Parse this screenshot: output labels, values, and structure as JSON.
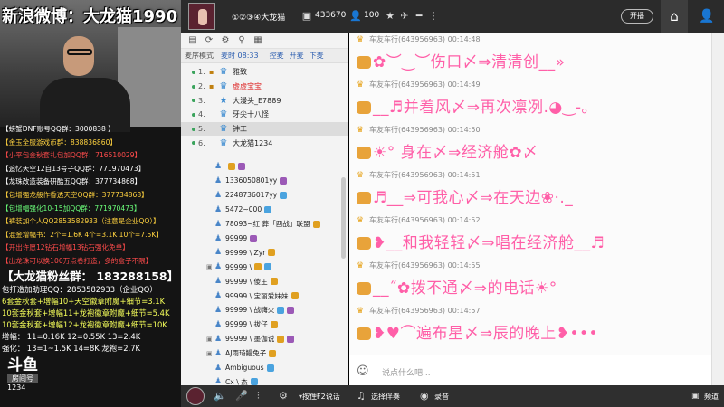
{
  "stream": {
    "title": "新浪微博：大龙猫1990",
    "lines": [
      {
        "text": "【螃蟹DNF账号QQ群：3000838 】",
        "cls": ""
      },
      {
        "text": "【金玉全服游戏币群：838836860】",
        "cls": "y"
      },
      {
        "text": "【小平包金秋套礼包加QQ群：716510029】",
        "cls": "r"
      },
      {
        "text": "【追忆天空12自13号子QQ群：771970473】",
        "cls": ""
      },
      {
        "text": "【龙珠改造装备研酷五QQ群：377734868】",
        "cls": ""
      },
      {
        "text": "【包增强龙般作香透天空QQ群：377734868】",
        "cls": "y"
      },
      {
        "text": "【包增幅强化10-15加QQ群：771970473】",
        "cls": "g"
      },
      {
        "text": "【裤装加个人QQ2853582933（注意是企业QQ）】",
        "cls": "y"
      },
      {
        "text": "【混金增幅书：2个=1.6K 4个=3.1K 10个=7.5K】",
        "cls": "y"
      },
      {
        "text": "【开出许愿12钻石增幅13钻石强化免单】",
        "cls": "r"
      },
      {
        "text": "【出龙珠可以换100万点卷打造，多的盒子不限】",
        "cls": "r"
      }
    ],
    "big": "【大龙猫粉丝群： 183288158】",
    "mid": [
      {
        "text": "包打造加助理QQ：2853582933（企业QQ）",
        "cls": ""
      },
      {
        "text": "6套金秋套+增幅10+天空徽章附魔+细节=3.1K",
        "cls": "y"
      },
      {
        "text": "10套金秋套+增幅11+龙袍徽章附魔+细节=5.4K",
        "cls": "y"
      },
      {
        "text": "10套金秋套+增幅12+龙袍徽章附魔+细节=10K",
        "cls": "y"
      },
      {
        "text": "增幅： 11=0.16K  12=0.55K  13=2.4K",
        "cls": ""
      },
      {
        "text": "强化： 13=1~1.5K  14=8K  龙袍=2.7K",
        "cls": ""
      }
    ],
    "logo_top": "斗鱼",
    "logo_mid": "房间号",
    "logo_num": "1234"
  },
  "topbar": {
    "channel_name": "①②③④大龙猫",
    "viewers": "433670",
    "online": "100",
    "open_screen": "开播"
  },
  "members": {
    "mode": "麦序模式",
    "time": "麦时 08:33",
    "links": [
      "控麦",
      "开麦",
      "下麦"
    ],
    "queue": [
      {
        "num": "1.",
        "name": "雅致",
        "red": false,
        "selected": false
      },
      {
        "num": "2.",
        "name": "虚虚宝宝",
        "red": true,
        "selected": false
      },
      {
        "num": "3.",
        "name": "大漫头_E7889",
        "red": false,
        "selected": false
      },
      {
        "num": "4.",
        "name": "牙尖十八怪",
        "red": false,
        "selected": false
      },
      {
        "num": "5.",
        "name": "钟工",
        "red": false,
        "selected": true
      },
      {
        "num": "6.",
        "name": "大龙猫1234",
        "red": false,
        "selected": false
      }
    ],
    "users": [
      {
        "name": "",
        "badges": [
          "o",
          "p"
        ],
        "lock": false
      },
      {
        "name": "1336050801yy",
        "badges": [
          "p"
        ],
        "lock": false
      },
      {
        "name": "2248736017yy",
        "badges": [
          "b"
        ],
        "lock": false
      },
      {
        "name": "5472~000",
        "badges": [
          "b"
        ],
        "lock": false
      },
      {
        "name": "78093~红 葬「酉战」联盟",
        "badges": [
          "o"
        ],
        "lock": false
      },
      {
        "name": "99999",
        "badges": [
          "p"
        ],
        "lock": false
      },
      {
        "name": "99999 \\ Zyr",
        "badges": [
          "o"
        ],
        "lock": false
      },
      {
        "name": "99999 \\",
        "badges": [
          "o",
          "b"
        ],
        "lock": true
      },
      {
        "name": "99999 \\ 傻王",
        "badges": [
          "o"
        ],
        "lock": false
      },
      {
        "name": "99999 \\ 宝丽爱妹妹",
        "badges": [
          "o"
        ],
        "lock": false
      },
      {
        "name": "99999 \\ 战嗨火",
        "badges": [
          "b",
          "p"
        ],
        "lock": false
      },
      {
        "name": "99999 \\ 拔仔",
        "badges": [
          "o"
        ],
        "lock": false
      },
      {
        "name": "99999 \\ 墨伽说",
        "badges": [
          "o",
          "p"
        ],
        "lock": true
      },
      {
        "name": "AJ雨琦鳗兔子",
        "badges": [
          "o"
        ],
        "lock": true
      },
      {
        "name": "Ambiguous",
        "badges": [
          "b"
        ],
        "lock": false
      },
      {
        "name": "Cx \\ 杰",
        "badges": [
          "b"
        ],
        "lock": false
      }
    ]
  },
  "chat": {
    "messages": [
      {
        "sender": "车友车行(643956963)",
        "time": "00:14:48",
        "text": "✿︶‿︶伤口〆⇒清清创__»"
      },
      {
        "sender": "车友车行(643956963)",
        "time": "00:14:49",
        "text": "__♬并着风〆⇒再次凛冽.◕‿-｡"
      },
      {
        "sender": "车友车行(643956963)",
        "time": "00:14:50",
        "text": "☀° 身在〆⇒经济舱✿〆"
      },
      {
        "sender": "车友车行(643956963)",
        "time": "00:14:51",
        "text": "♬__⇒可我心〆⇒在天边❀·._"
      },
      {
        "sender": "车友车行(643956963)",
        "time": "00:14:52",
        "text": "❥__和我轻轻〆⇒唱在经济舱__♬"
      },
      {
        "sender": "车友车行(643956963)",
        "time": "00:14:55",
        "text": "__˝✿拨不通〆⇒的电话☀°"
      },
      {
        "sender": "车友车行(643956963)",
        "time": "00:14:57",
        "text": "❥♥⌒遍布星〆⇒辰的晚上❥•••"
      }
    ],
    "input_placeholder": "说点什么吧..."
  },
  "bottombar": {
    "f2": "按住F2说话",
    "accompany": "选择伴奏",
    "record": "录音",
    "more": "频道"
  }
}
